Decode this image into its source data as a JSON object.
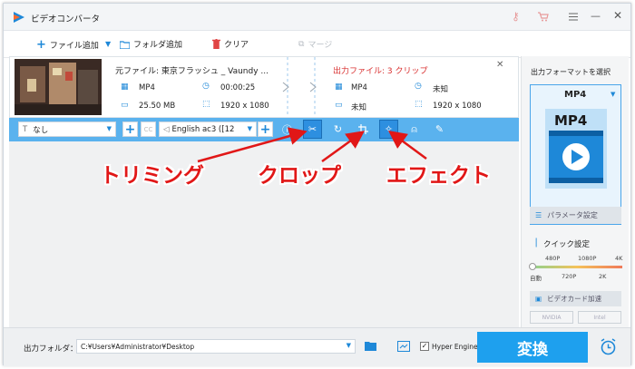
{
  "app": {
    "title": "ビデオコンバータ"
  },
  "toolbar": {
    "add_file": "ファイル追加",
    "add_folder": "フォルダ追加",
    "clear": "クリア",
    "merge": "マージ"
  },
  "source": {
    "label": "元ファイル: 東京フラッシュ _ Vaundy ...",
    "format": "MP4",
    "duration": "00:00:25",
    "size": "25.50 MB",
    "resolution": "1920 x 1080"
  },
  "output": {
    "label": "出力ファイル: 3 クリップ",
    "format": "MP4",
    "duration": "未知",
    "size": "未知",
    "resolution": "1920 x 1080"
  },
  "controls": {
    "subtitle_value": "なし",
    "audio_value": "English ac3 ([12",
    "cc_label": "CC"
  },
  "right_panel": {
    "title": "出力フォーマットを選択",
    "format_name": "MP4",
    "format_tile_label": "MP4",
    "param_button": "パラメータ設定",
    "quick_label": "クイック設定",
    "quick_top": [
      "480P",
      "1080P",
      "4K"
    ],
    "quick_bottom": [
      "自動",
      "720P",
      "2K"
    ],
    "gpu_button": "ビデオカード加速",
    "gpu_vendors": [
      "NVIDIA",
      "Intel"
    ]
  },
  "bottom": {
    "folder_label": "出力フォルダ：",
    "folder_path": "C:¥Users¥Administrator¥Desktop",
    "hyper_label": "Hyper Engine",
    "convert_label": "変換"
  },
  "annotations": {
    "trim": "トリミング",
    "crop": "クロップ",
    "effect": "エフェクト"
  },
  "colors": {
    "accent": "#1e88d8",
    "bar": "#5ab2ee",
    "convert": "#1ea0ee",
    "annotation": "#e11717"
  }
}
